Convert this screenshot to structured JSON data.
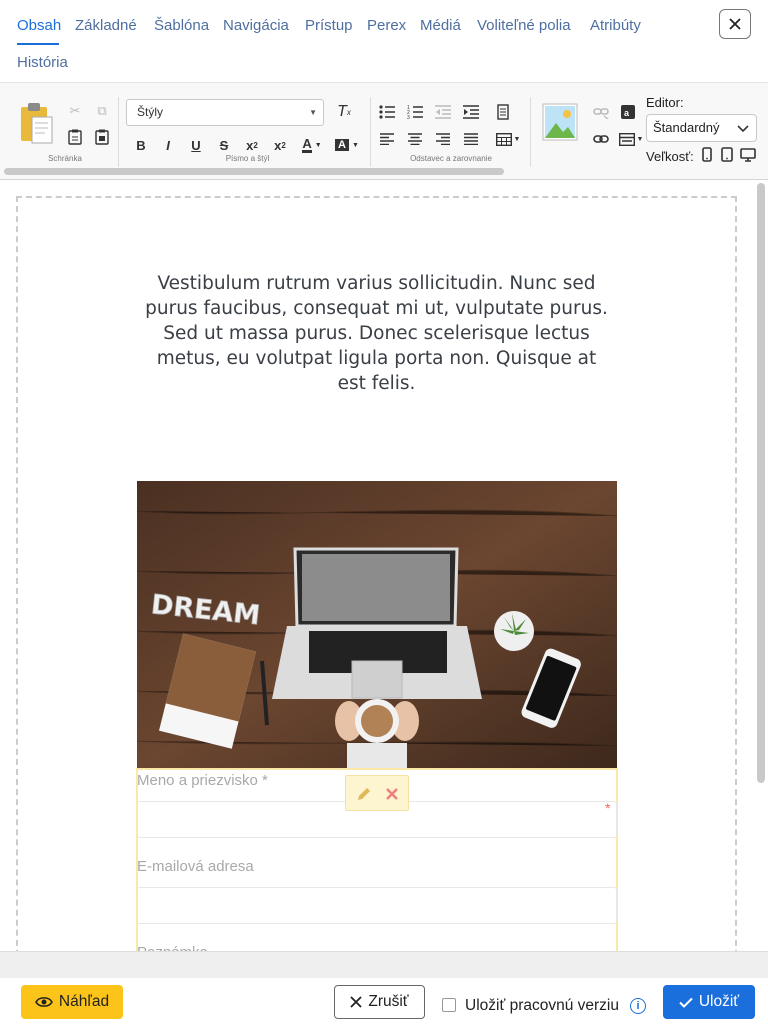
{
  "tabs": [
    "Obsah",
    "Základné",
    "Šablóna",
    "Navigácia",
    "Prístup",
    "Perex",
    "Médiá",
    "Voliteľné polia",
    "Atribúty",
    "História"
  ],
  "toolbar": {
    "group_clipboard": "Schránka",
    "group_font": "Písmo a štýl",
    "group_paragraph": "Odstavec a zarovnanie",
    "styles_value": "Štýly",
    "editor_label": "Editor:",
    "editor_value": "Štandardný",
    "size_label": "Veľkosť:"
  },
  "content": {
    "paragraph": "Vestibulum rutrum varius sollicitudin. Nunc sed purus faucibus, consequat mi ut, vulputate purus. Sed ut massa purus. Donec scelerisque lectus metus, eu volutpat ligula porta non. Quisque at est felis.",
    "image_word": "DREAM",
    "form": {
      "name_label": "Meno a priezvisko *",
      "email_label": "E-mailová adresa",
      "note_label": "Poznámka",
      "required_star": "*"
    }
  },
  "footer": {
    "preview_label": "Náhľad",
    "cancel_label": "Zrušiť",
    "work_version_label": "Uložiť pracovnú verziu",
    "save_label": "Uložiť"
  },
  "colors": {
    "accent": "#1b6fdd",
    "preview_button": "#fcc419",
    "form_highlight": "#fbe8a6"
  }
}
